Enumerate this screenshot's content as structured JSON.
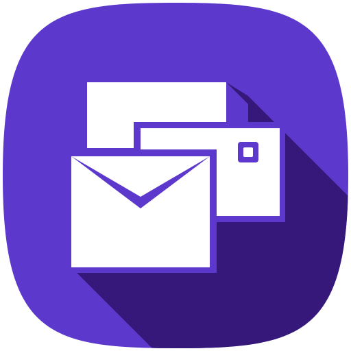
{
  "icon": {
    "name": "mail-envelopes-app-icon",
    "colors": {
      "background": "#5c38cc",
      "shadow": "#35187a",
      "paper": "#ffffff"
    }
  }
}
